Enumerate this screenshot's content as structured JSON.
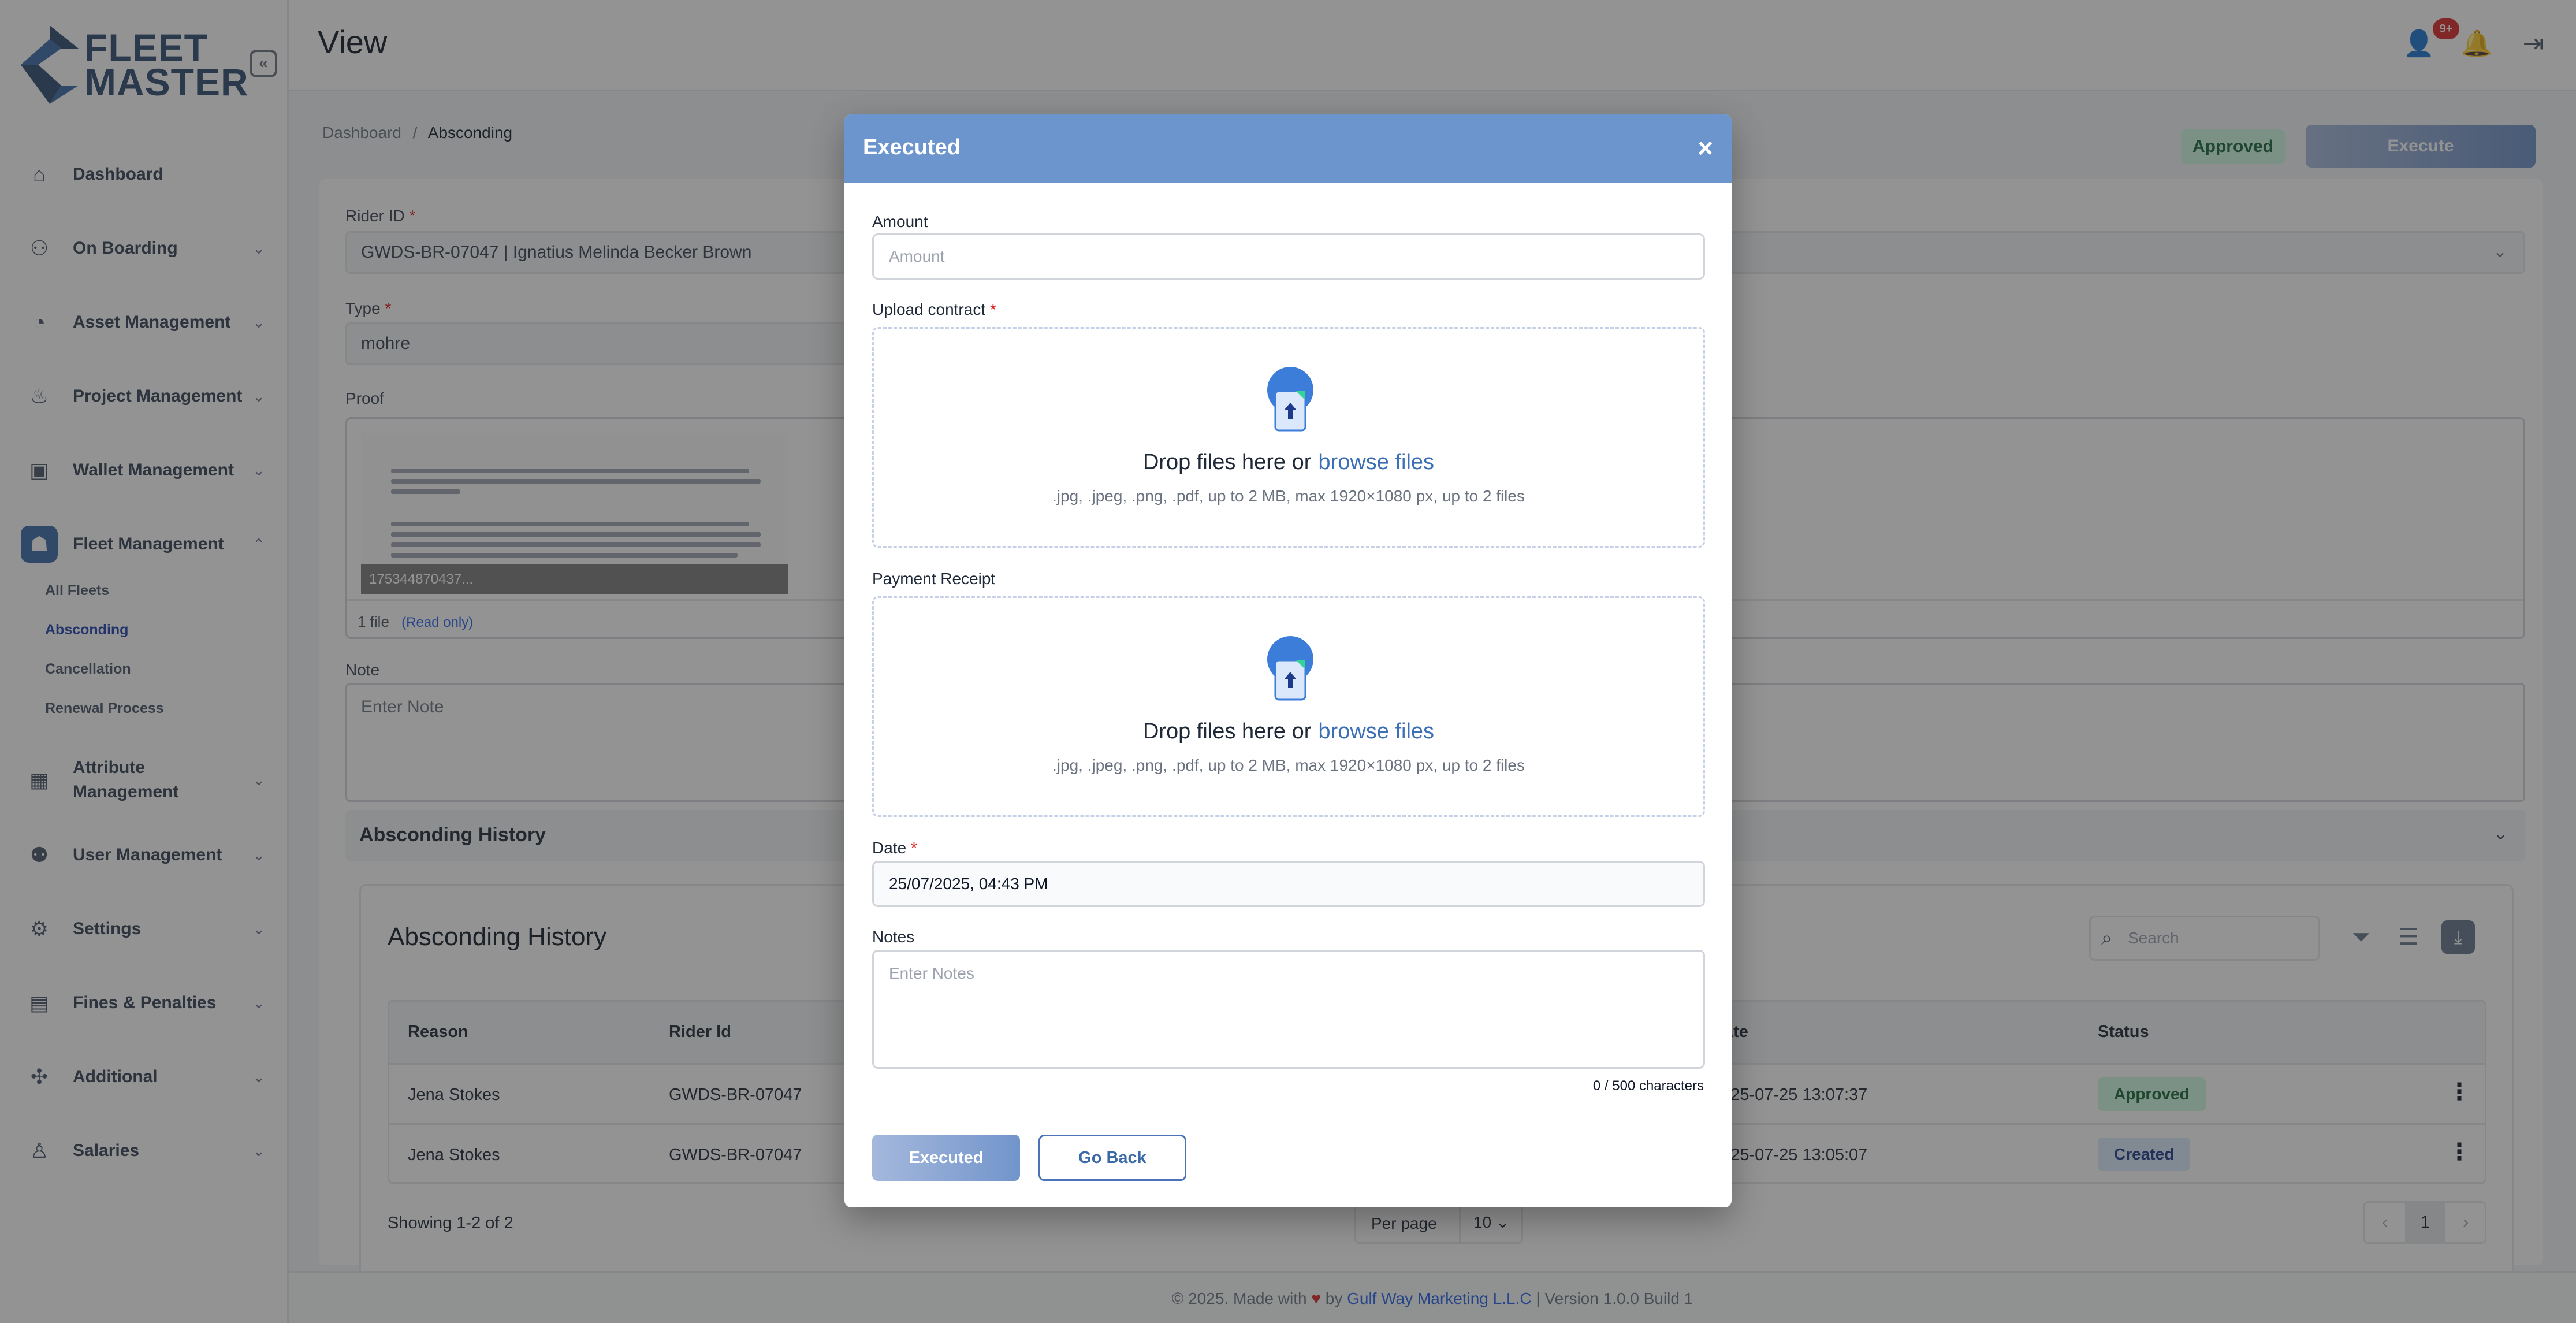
{
  "sidebar": {
    "logo_line1": "FLEET",
    "logo_line2": "MASTER",
    "collapse_icon": "«",
    "items": [
      {
        "label": "Dashboard",
        "icon": "home-icon",
        "glyph": "⌂"
      },
      {
        "label": "On Boarding",
        "icon": "onboarding-icon",
        "glyph": "⚇"
      },
      {
        "label": "Asset Management",
        "icon": "asset-icon",
        "glyph": "◔"
      },
      {
        "label": "Project Management",
        "icon": "project-icon",
        "glyph": "♨"
      },
      {
        "label": "Wallet Management",
        "icon": "wallet-icon",
        "glyph": "▣"
      },
      {
        "label": "Fleet Management",
        "icon": "fleet-icon",
        "glyph": "☗"
      },
      {
        "label": "Attribute Management",
        "icon": "attribute-icon",
        "glyph": "▦"
      },
      {
        "label": "User Management",
        "icon": "user-management-icon",
        "glyph": "⚉"
      },
      {
        "label": "Settings",
        "icon": "gear-icon",
        "glyph": "⚙"
      },
      {
        "label": "Fines & Penalties",
        "icon": "fines-icon",
        "glyph": "▤"
      },
      {
        "label": "Additional",
        "icon": "additional-icon",
        "glyph": "✣"
      },
      {
        "label": "Salaries",
        "icon": "salaries-icon",
        "glyph": "♙"
      }
    ],
    "fleet_sub_items": [
      "All Fleets",
      "Absconding",
      "Cancellation",
      "Renewal Process"
    ]
  },
  "header": {
    "title": "View",
    "notification_count": "9+"
  },
  "breadcrumb": {
    "root": "Dashboard",
    "separator": "/",
    "current": "Absconding"
  },
  "actions": {
    "status": "Approved",
    "execute_label": "Execute"
  },
  "form": {
    "rider_label": "Rider ID",
    "rider_value": "GWDS-BR-07047 | Ignatius Melinda Becker Brown",
    "type_label": "Type",
    "type_value": "mohre",
    "proof_label": "Proof",
    "proof_filename": "175344870437...",
    "proof_count": "1 file",
    "proof_readonly": "(Read only)",
    "note_label": "Note",
    "note_placeholder": "Enter Note",
    "required_mark": "*"
  },
  "history": {
    "accordion_title": "Absconding History",
    "card_title": "Absconding History",
    "search_placeholder": "Search",
    "columns": [
      "Reason",
      "Rider Id",
      "Date",
      "Status"
    ],
    "rows": [
      {
        "reason": "Jena Stokes",
        "rider_id": "GWDS-BR-07047",
        "date": "2025-07-25 13:07:37",
        "status": "Approved"
      },
      {
        "reason": "Jena Stokes",
        "rider_id": "GWDS-BR-07047",
        "date": "2025-07-25 13:05:07",
        "status": "Created"
      }
    ],
    "showing": "Showing 1-2 of 2",
    "per_page_label": "Per page",
    "per_page_value": "10",
    "current_page": "1"
  },
  "footer": {
    "prefix": "© 2025. Made with",
    "by": "by",
    "company": "Gulf Way Marketing L.L.C",
    "version": "| Version 1.0.0 Build 1"
  },
  "modal": {
    "title": "Executed",
    "close_glyph": "×",
    "amount_label": "Amount",
    "amount_placeholder": "Amount",
    "contract_label": "Upload contract",
    "receipt_label": "Payment Receipt",
    "drop_text": "Drop files here or",
    "browse_text": "browse files",
    "drop_hint": ".jpg, .jpeg, .png, .pdf, up to 2 MB, max 1920×1080 px, up to 2 files",
    "date_label": "Date",
    "date_value": "25/07/2025, 04:43 PM",
    "notes_label": "Notes",
    "notes_placeholder": "Enter Notes",
    "char_counter": "0 / 500 characters",
    "submit_label": "Executed",
    "back_label": "Go Back"
  },
  "colors": {
    "primary": "#3b6aa8",
    "modal_header": "#6b95cc",
    "approved_bg": "#d1fae5",
    "created_bg": "#dbeafe",
    "danger": "#dc2626"
  }
}
